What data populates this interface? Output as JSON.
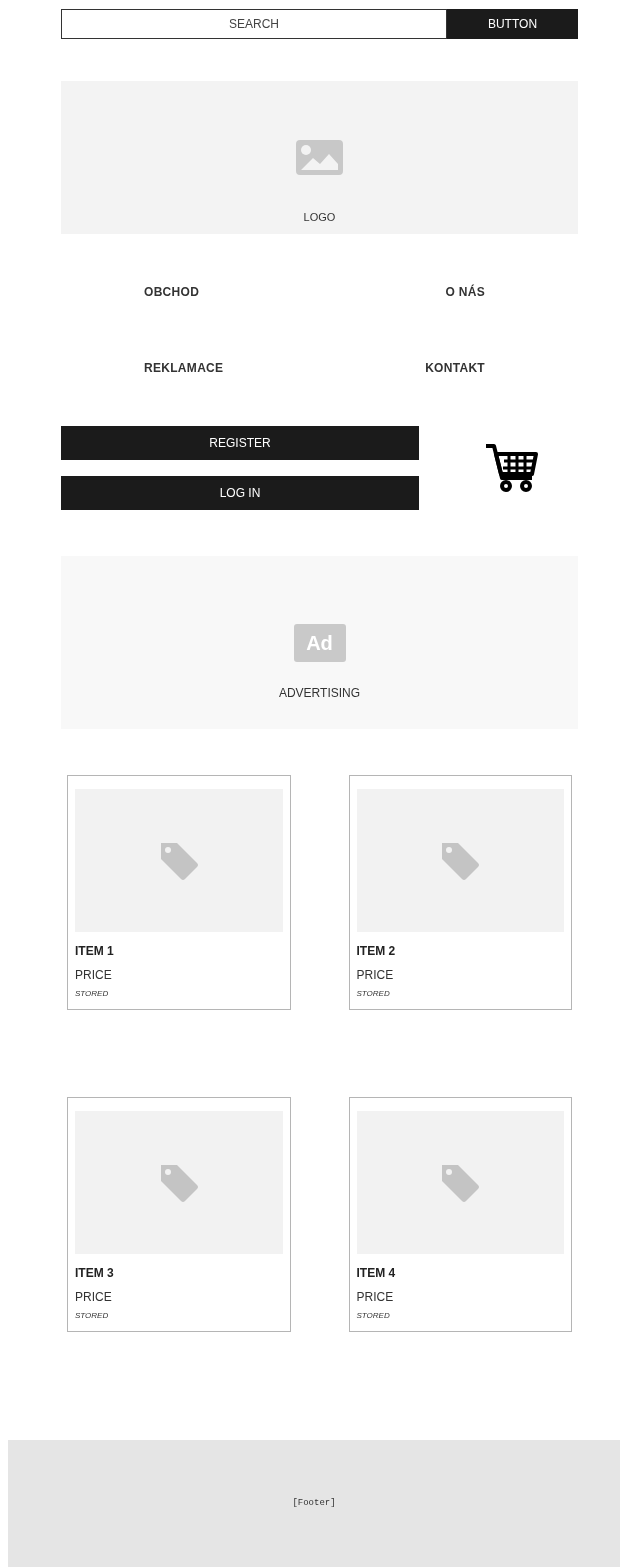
{
  "search": {
    "placeholder": "SEARCH",
    "button": "BUTTON"
  },
  "logo": {
    "label": "LOGO"
  },
  "nav": [
    "OBCHOD",
    "O NÁS",
    "REKLAMACE",
    "KONTAKT"
  ],
  "auth_buttons": [
    "REGISTER",
    "LOG IN"
  ],
  "advertising": {
    "label": "ADVERTISING",
    "badge": "Ad"
  },
  "products": [
    {
      "name": "ITEM 1",
      "price": "PRICE",
      "stock": "STORED"
    },
    {
      "name": "ITEM 2",
      "price": "PRICE",
      "stock": "STORED"
    },
    {
      "name": "ITEM 3",
      "price": "PRICE",
      "stock": "STORED"
    },
    {
      "name": "ITEM 4",
      "price": "PRICE",
      "stock": "STORED"
    }
  ],
  "footer": "[Footer]"
}
